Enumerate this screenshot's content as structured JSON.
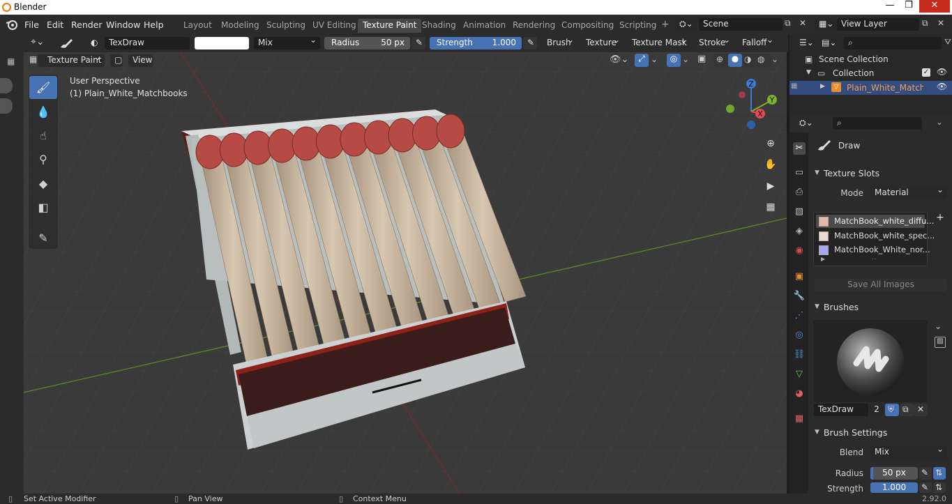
{
  "window": {
    "title": "Blender",
    "minimize": "—",
    "maximize": "❐",
    "close": "✕"
  },
  "menu": {
    "items": [
      "File",
      "Edit",
      "Render",
      "Window",
      "Help"
    ]
  },
  "workspaces": {
    "tabs": [
      "Layout",
      "Modeling",
      "Sculpting",
      "UV Editing",
      "Texture Paint",
      "Shading",
      "Animation",
      "Rendering",
      "Compositing",
      "Scripting"
    ],
    "active": "Texture Paint",
    "add": "+"
  },
  "scene": {
    "name": "Scene",
    "view_layer": "View Layer"
  },
  "toolsettings": {
    "brush_name": "TexDraw",
    "blend": "Mix",
    "radius_label": "Radius",
    "radius_value": "50 px",
    "strength_label": "Strength",
    "strength_value": "1.000",
    "strength_fraction": 1.0,
    "menus": [
      "Brush",
      "Texture",
      "Texture Mask",
      "Stroke",
      "Falloff"
    ]
  },
  "viewheader": {
    "mode": "Texture Paint",
    "view": "View"
  },
  "viewport": {
    "perspective": "User Perspective",
    "object_info": "(1) Plain_White_Matchbooks",
    "colors": {
      "grid_bg": "#3a3a3a",
      "x_axis": "#7a2a2a",
      "y_axis": "#5c8a2c"
    }
  },
  "gizmo": {
    "x": "X",
    "y": "Y",
    "z": "Z",
    "colors": {
      "x": "#e84a5a",
      "y": "#7eb32a",
      "z": "#3f7ad6"
    }
  },
  "outliner": {
    "scene_collection": "Scene Collection",
    "collection": "Collection",
    "object": "Plain_White_Matchbc"
  },
  "properties": {
    "tool_name": "Draw",
    "texture_slots": {
      "header": "Texture Slots",
      "mode_label": "Mode",
      "mode_value": "Material",
      "slots": [
        "MatchBook_white_diffu...",
        "MatchBook_white_spec...",
        "MatchBook_White_nor..."
      ],
      "save_all": "Save All Images",
      "add": "+"
    },
    "brushes": {
      "header": "Brushes",
      "brush_name": "TexDraw",
      "users": "2"
    },
    "brush_settings": {
      "header": "Brush Settings",
      "blend_label": "Blend",
      "blend_value": "Mix",
      "radius_label": "Radius",
      "radius_value": "50 px",
      "strength_label": "Strength",
      "strength_value": "1.000"
    }
  },
  "statusbar": {
    "left": "Set Active Modifier",
    "middle": "Pan View",
    "right": "Context Menu",
    "version": "2.92.0"
  }
}
